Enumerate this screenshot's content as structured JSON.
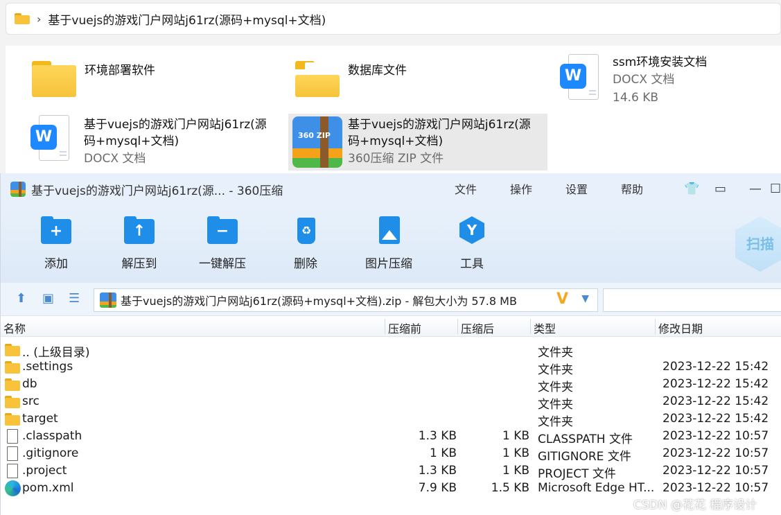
{
  "explorer": {
    "breadcrumb": "基于vuejs的游戏门户网站j61rz(源码+mysql+文档)",
    "items": [
      {
        "name": "环境部署软件",
        "type": "",
        "size": "",
        "icon": "folder-icon"
      },
      {
        "name": "数据库文件",
        "type": "",
        "size": "",
        "icon": "folder-with-papers-icon"
      },
      {
        "name": "ssm环境安装文档",
        "type": "DOCX 文档",
        "size": "14.6 KB",
        "icon": "word-docx-icon"
      },
      {
        "name1": "基于vuejs的游戏门户网站j61rz(源",
        "name2": "码+mysql+文档)",
        "type": "DOCX 文档",
        "icon": "word-docx-icon"
      },
      {
        "name1": "基于vuejs的游戏门户网站j61rz(源",
        "name2": "码+mysql+文档)",
        "type": "360压缩 ZIP 文件",
        "icon": "zip-archive-icon",
        "zip_label": "360 ZIP"
      }
    ]
  },
  "app": {
    "title": "基于vuejs的游戏门户网站j61rz(源... - 360压缩",
    "menu": [
      "文件",
      "操作",
      "设置",
      "帮助"
    ],
    "toolbar": [
      {
        "label": "添加",
        "icon": "add-folder-icon"
      },
      {
        "label": "解压到",
        "icon": "extract-to-icon"
      },
      {
        "label": "一键解压",
        "icon": "one-click-extract-icon"
      },
      {
        "label": "删除",
        "icon": "delete-bin-icon"
      },
      {
        "label": "图片压缩",
        "icon": "image-compress-icon"
      },
      {
        "label": "工具",
        "icon": "tools-icon"
      }
    ],
    "scan_label": "扫描",
    "path": "基于vuejs的游戏门户网站j61rz(源码+mysql+文档).zip - 解包大小为 57.8 MB",
    "columns": [
      "名称",
      "压缩前",
      "压缩后",
      "类型",
      "修改日期"
    ],
    "rows": [
      {
        "name": ".. (上级目录)",
        "before": "",
        "after": "",
        "type": "文件夹",
        "date": "",
        "kind": "folder"
      },
      {
        "name": ".settings",
        "before": "",
        "after": "",
        "type": "文件夹",
        "date": "2023-12-22 15:42",
        "kind": "folder"
      },
      {
        "name": "db",
        "before": "",
        "after": "",
        "type": "文件夹",
        "date": "2023-12-22 15:42",
        "kind": "folder"
      },
      {
        "name": "src",
        "before": "",
        "after": "",
        "type": "文件夹",
        "date": "2023-12-22 15:42",
        "kind": "folder"
      },
      {
        "name": "target",
        "before": "",
        "after": "",
        "type": "文件夹",
        "date": "2023-12-22 15:42",
        "kind": "folder"
      },
      {
        "name": ".classpath",
        "before": "1.3 KB",
        "after": "1 KB",
        "type": "CLASSPATH 文件",
        "date": "2023-12-22 10:57",
        "kind": "file"
      },
      {
        "name": ".gitignore",
        "before": "1 KB",
        "after": "1 KB",
        "type": "GITIGNORE 文件",
        "date": "2023-12-22 10:57",
        "kind": "file"
      },
      {
        "name": ".project",
        "before": "1.3 KB",
        "after": "1 KB",
        "type": "PROJECT 文件",
        "date": "2023-12-22 10:57",
        "kind": "file"
      },
      {
        "name": "pom.xml",
        "before": "7.9 KB",
        "after": "1.5 KB",
        "type": "Microsoft Edge HT...",
        "date": "2023-12-22 10:57",
        "kind": "edge"
      }
    ]
  },
  "watermark": "CSDN @花花 程序设计"
}
